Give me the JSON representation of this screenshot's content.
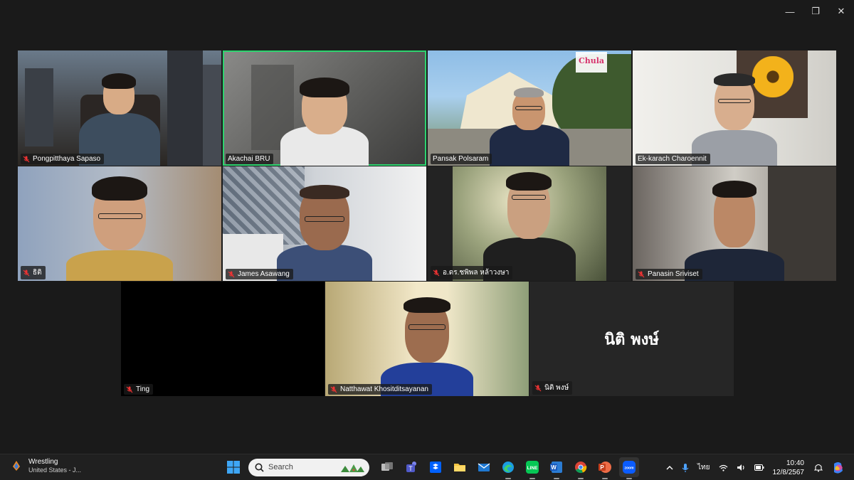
{
  "window": {
    "minimize_glyph": "—",
    "restore_glyph": "❐",
    "close_glyph": "✕"
  },
  "participants": [
    {
      "name": "Pongpitthaya Sapaso",
      "muted": true
    },
    {
      "name": "Akachai BRU",
      "muted": false,
      "active_speaker": true
    },
    {
      "name": "Pansak Polsaram",
      "muted": false
    },
    {
      "name": "Ek-karach Charoennit",
      "muted": false
    },
    {
      "name": "ธิติ",
      "muted": true
    },
    {
      "name": "James Asawang",
      "muted": true
    },
    {
      "name": "อ.ดร.ชพิพล หล้าวงษา",
      "muted": true
    },
    {
      "name": "Panasin Sriviset",
      "muted": true
    },
    {
      "name": "Ting",
      "muted": true
    },
    {
      "name": "Natthawat Khositditsayanan",
      "muted": true
    },
    {
      "name": "นิติ พงษ์",
      "muted": true,
      "display_name": "นิติ พงษ์"
    }
  ],
  "overlays": {
    "chula_logo": "Chula"
  },
  "taskbar": {
    "weather_title": "Wrestling",
    "weather_subtitle": "United States - J...",
    "search_placeholder": "Search",
    "language": "ไทย",
    "time": "10:40",
    "date": "12/8/2567",
    "colors": {
      "accent": "#2dd36f",
      "taskbar_bg": "#202020",
      "background": "#1a1a1a"
    },
    "apps": [
      "windows-start-icon",
      "search",
      "task-view-icon",
      "teams-icon",
      "dropbox-icon",
      "file-explorer-icon",
      "mail-icon",
      "edge-icon",
      "line-icon",
      "word-icon",
      "chrome-icon",
      "powerpoint-icon",
      "zoom-icon"
    ]
  }
}
